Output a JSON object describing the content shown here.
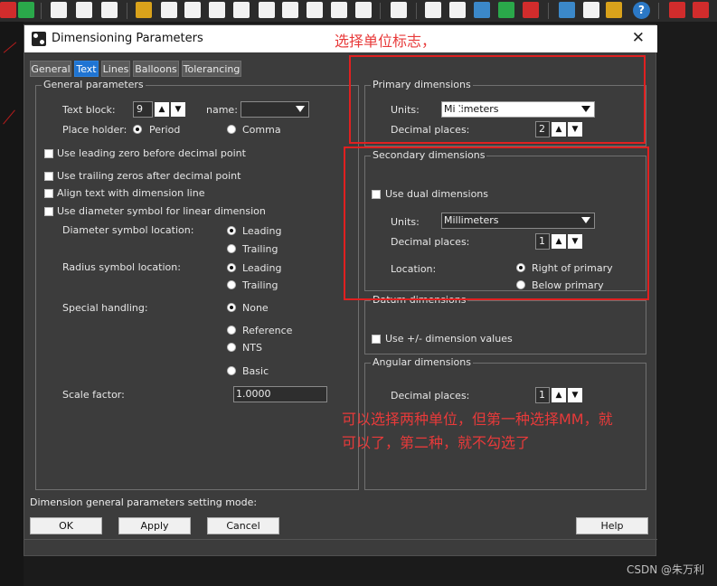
{
  "dialog": {
    "title": "Dimensioning Parameters",
    "close_glyph": "✕",
    "tabs": [
      {
        "label": "General",
        "active": false
      },
      {
        "label": "Text",
        "active": true
      },
      {
        "label": "Lines",
        "active": false
      },
      {
        "label": "Balloons",
        "active": false
      },
      {
        "label": "Tolerancing",
        "active": false
      }
    ]
  },
  "general": {
    "title": "General parameters",
    "text_block_label": "Text block:",
    "text_block_value": "9",
    "name_label": "name:",
    "name_value": "",
    "place_holder_label": "Place holder:",
    "period_label": "Period",
    "comma_label": "Comma",
    "leading_zero_label": "Use leading zero before decimal point",
    "trailing_zeros_label": "Use trailing zeros after decimal point",
    "align_text_label": "Align text with dimension line",
    "diameter_symbol_label": "Use diameter symbol for linear dimension",
    "diameter_location_label": "Diameter symbol location:",
    "radius_location_label": "Radius symbol location:",
    "leading_label": "Leading",
    "trailing_label": "Trailing",
    "special_handling_label": "Special handling:",
    "none_label": "None",
    "reference_label": "Reference",
    "nts_label": "NTS",
    "basic_label": "Basic",
    "scale_factor_label": "Scale factor:",
    "scale_factor_value": "1.0000"
  },
  "primary": {
    "title": "Primary dimensions",
    "units_label": "Units:",
    "units_value": "Millimeters",
    "decimal_label": "Decimal places:",
    "decimal_value": "2"
  },
  "secondary": {
    "title": "Secondary dimensions",
    "use_dual_label": "Use dual dimensions",
    "units_label": "Units:",
    "units_value": "Millimeters",
    "decimal_label": "Decimal places:",
    "decimal_value": "1",
    "location_label": "Location:",
    "right_label": "Right of primary",
    "below_label": "Below primary"
  },
  "datum": {
    "title": "Datum dimensions",
    "plusminus_label": "Use +/- dimension values"
  },
  "angular": {
    "title": "Angular dimensions",
    "decimal_label": "Decimal places:",
    "decimal_value": "1"
  },
  "status": {
    "mode_text": "Dimension general parameters setting mode:"
  },
  "buttons": {
    "ok": "OK",
    "apply": "Apply",
    "cancel": "Cancel",
    "help": "Help"
  },
  "annotations": {
    "top": "选择单位标志，",
    "bottom_line1": "可以选择两种单位，但第一种选择MM，就",
    "bottom_line2": "可以了，第二种，就不勾选了",
    "color": "#e02020"
  },
  "toolbar": {
    "help_glyph": "?"
  },
  "watermark": "CSDN @朱万利",
  "colors": {
    "dialog_bg": "#3c3c3c",
    "active_tab": "#1f74d3",
    "annotation_red": "#e02020"
  }
}
